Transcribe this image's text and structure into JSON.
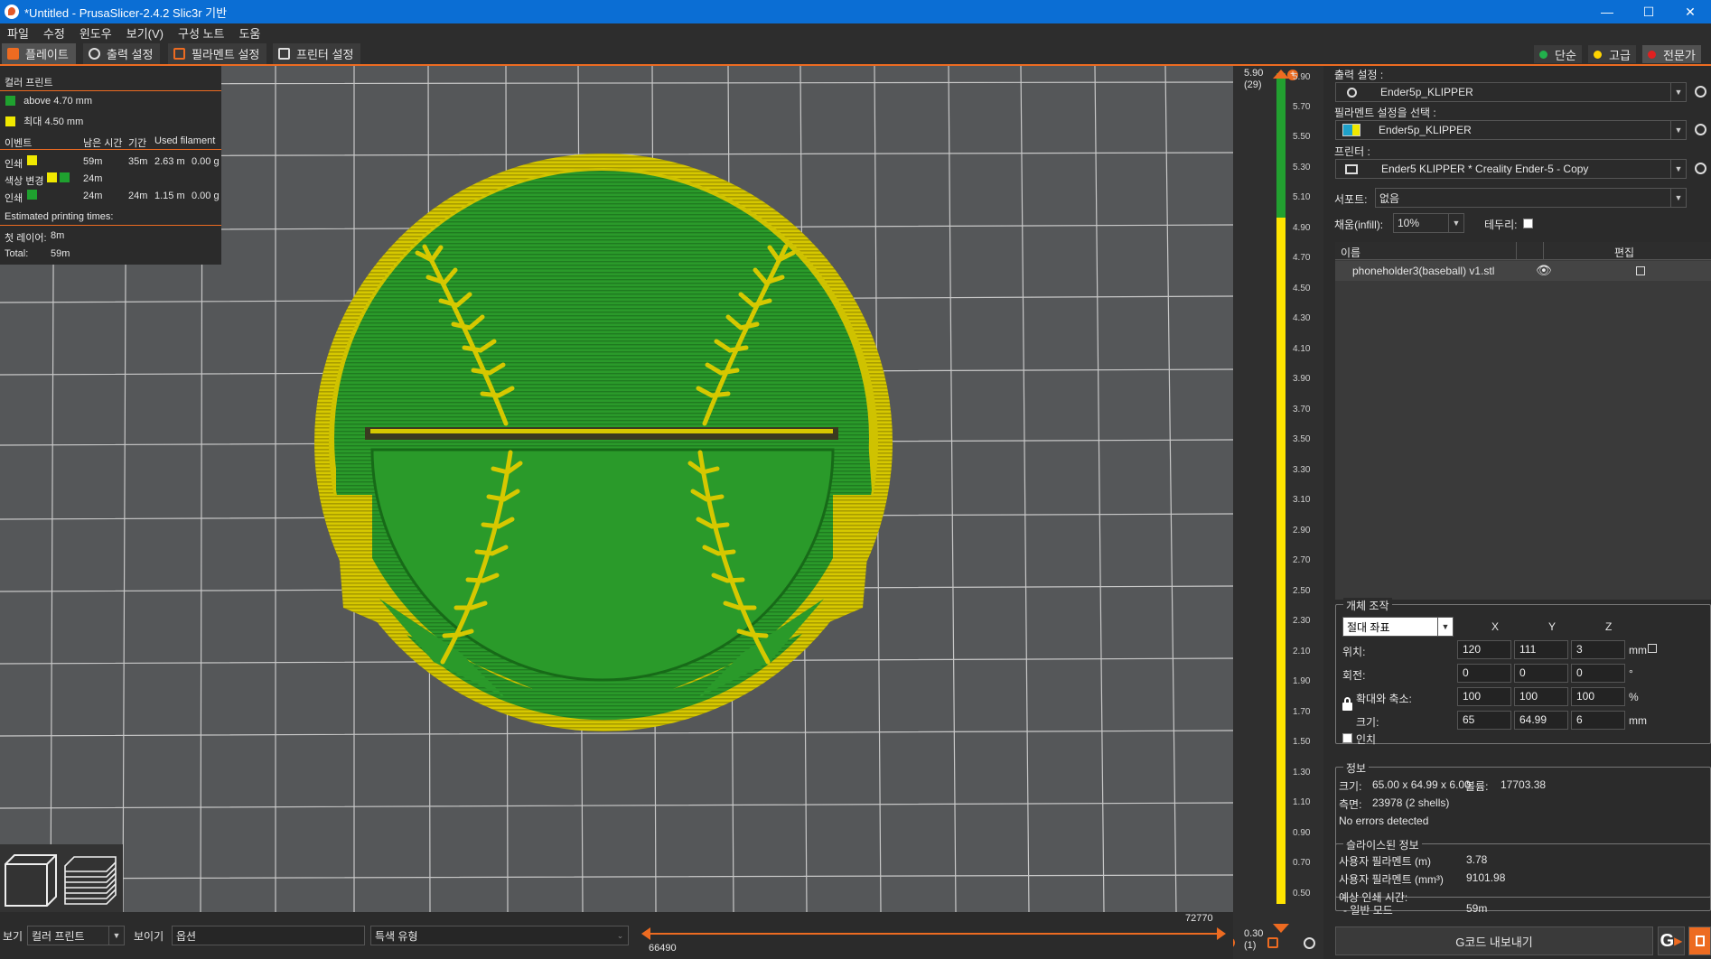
{
  "window": {
    "title": "*Untitled - PrusaSlicer-2.4.2 Slic3r 기반",
    "controls": [
      "—",
      "☐",
      "✕"
    ]
  },
  "menu": [
    "파일",
    "수정",
    "윈도우",
    "보기(V)",
    "구성 노트",
    "도움"
  ],
  "tabs": [
    "플레이트",
    "출력 설정",
    "필라멘트 설정",
    "프린터 설정"
  ],
  "modes": [
    {
      "label": "단순",
      "color": "#22b14c"
    },
    {
      "label": "고급",
      "color": "#ffd400"
    },
    {
      "label": "전문가",
      "color": "#e02020"
    }
  ],
  "legend": {
    "title": "컬러 프린트",
    "items": [
      {
        "label": "above 4.70 mm",
        "color": "#1fa12f"
      },
      {
        "label": "최대 4.50 mm",
        "color": "#f0e800"
      }
    ],
    "headers": [
      "이벤트",
      "남은 시간",
      "기간",
      "Used filament"
    ],
    "rows": [
      {
        "event": "인쇄",
        "colors": [
          "#f0e800"
        ],
        "remaining": "59m",
        "duration": "35m",
        "length": "2.63 m",
        "weight": "0.00 g"
      },
      {
        "event": "색상 변경",
        "colors": [
          "#f0e800",
          "#1fa12f"
        ],
        "remaining": "24m",
        "duration": "",
        "length": "",
        "weight": ""
      },
      {
        "event": "인쇄",
        "colors": [
          "#1fa12f"
        ],
        "remaining": "24m",
        "duration": "24m",
        "length": "1.15 m",
        "weight": "0.00 g"
      }
    ],
    "estimated": "Estimated printing times:",
    "first_layer_label": "첫 레이어:",
    "first_layer": "8m",
    "total_label": "Total:",
    "total": "59m"
  },
  "layer_slider": {
    "top_value": "5.90",
    "top_count": "(29)",
    "bottom_value": "0.30",
    "bottom_count": "(1)",
    "ticks": [
      "5.90",
      "5.70",
      "5.50",
      "5.30",
      "5.10",
      "4.90",
      "4.70",
      "4.50",
      "4.30",
      "4.10",
      "3.90",
      "3.70",
      "3.50",
      "3.30",
      "3.10",
      "2.90",
      "2.70",
      "2.50",
      "2.30",
      "2.10",
      "1.90",
      "1.70",
      "1.50",
      "1.30",
      "1.10",
      "0.90",
      "0.70",
      "0.50",
      "0.30"
    ]
  },
  "bottom": {
    "view_label": "보기",
    "view_value": "컬러 프린트",
    "show_label": "보이기",
    "show_value": "옵션",
    "feature_value": "특색 유형",
    "moves_end": "72770",
    "moves_start": "66490"
  },
  "settings": {
    "print_label": "출력 설정 :",
    "print_value": "Ender5p_KLIPPER",
    "filament_label": "필라멘트 설정을 선택 :",
    "filament_value": "Ender5p_KLIPPER",
    "printer_label": "프린터 :",
    "printer_value": "Ender5 KLIPPER * Creality Ender-5 - Copy",
    "support_label": "서포트:",
    "support_value": "없음",
    "infill_label": "채움(infill):",
    "infill_value": "10%",
    "brim_label": "테두리:"
  },
  "object_list": {
    "header_name": "이름",
    "header_edit": "편집",
    "items": [
      "phoneholder3(baseball) v1.stl"
    ]
  },
  "manipulation": {
    "title": "개체 조작",
    "coords": "절대 좌표",
    "axes": [
      "X",
      "Y",
      "Z"
    ],
    "position_label": "위치:",
    "position": [
      "120",
      "111",
      "3"
    ],
    "position_unit": "mm",
    "rotation_label": "회전:",
    "rotation": [
      "0",
      "0",
      "0"
    ],
    "rotation_unit": "°",
    "scale_label": "확대와 축소:",
    "scale": [
      "100",
      "100",
      "100"
    ],
    "scale_unit": "%",
    "size_label": "크기:",
    "size": [
      "65",
      "64.99",
      "6"
    ],
    "size_unit": "mm",
    "inch_label": "인치"
  },
  "info": {
    "title": "정보",
    "size_label": "크기:",
    "size": "65.00 x 64.99 x 6.00",
    "volume_label": "볼륨:",
    "volume": "17703.38",
    "facets_label": "측면:",
    "facets": "23978 (2 shells)",
    "errors": "No errors detected"
  },
  "sliced": {
    "title": "슬라이스된 정보",
    "fil_m_label": "사용자 필라멘트 (m)",
    "fil_m": "3.78",
    "fil_mm3_label": "사용자 필라멘트 (mm³)",
    "fil_mm3": "9101.98",
    "time_label": "예상 인쇄 시간:",
    "normal_label": "- 일반 모드",
    "normal": "59m"
  },
  "export_label": "G코드 내보내기"
}
